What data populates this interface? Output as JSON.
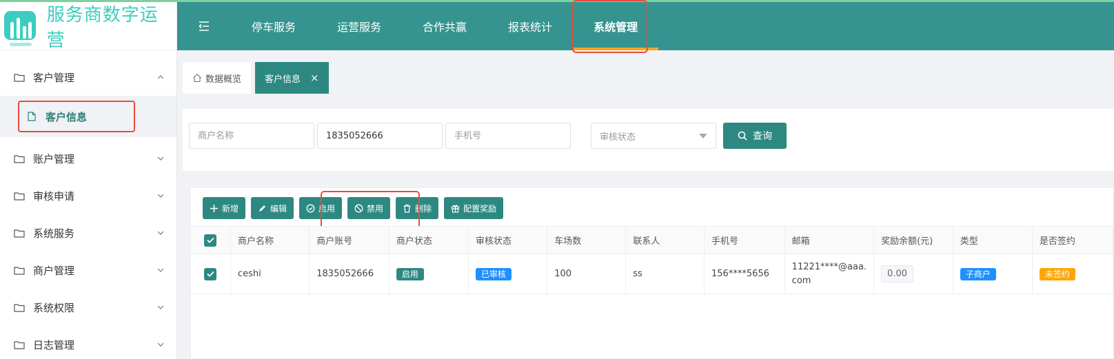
{
  "app": {
    "title": "服务商数字运营"
  },
  "sidebar": {
    "items": [
      {
        "label": "客户管理",
        "expanded": true
      },
      {
        "label": "账户管理"
      },
      {
        "label": "审核申请"
      },
      {
        "label": "系统服务"
      },
      {
        "label": "商户管理"
      },
      {
        "label": "系统权限"
      },
      {
        "label": "日志管理"
      }
    ],
    "sub_active": "客户信息"
  },
  "header": {
    "nav": [
      "停车服务",
      "运营服务",
      "合作共赢",
      "报表统计",
      "系统管理"
    ],
    "active": "系统管理"
  },
  "tabs": [
    {
      "label": "数据概览"
    },
    {
      "label": "客户信息",
      "close": "×"
    }
  ],
  "search": {
    "merchant_name_placeholder": "商户名称",
    "account_value": "1835052666",
    "phone_placeholder": "手机号",
    "audit_status_placeholder": "审核状态",
    "query_label": "查询"
  },
  "toolbar": {
    "add": "新增",
    "edit": "编辑",
    "enable": "启用",
    "disable": "禁用",
    "delete": "删除",
    "reward": "配置奖励"
  },
  "table": {
    "headers": [
      "商户名称",
      "商户账号",
      "商户状态",
      "审核状态",
      "车场数",
      "联系人",
      "手机号",
      "邮箱",
      "奖励余额(元)",
      "类型",
      "是否签约"
    ],
    "rows": [
      {
        "name": "ceshi",
        "account": "1835052666",
        "status": "启用",
        "audit": "已审核",
        "lots": "100",
        "contact": "ss",
        "phone": "156****5656",
        "email_line1": "11221****@aaa.",
        "email_line2": "com",
        "balance": "0.00",
        "type": "子商户",
        "signed": "未签约"
      }
    ]
  },
  "colors": {
    "brand": "#35948f",
    "primary": "#2e8882",
    "accent": "#f5a623",
    "highlight": "#e74c3c",
    "blue_badge": "#1e90ff",
    "orange_badge": "#ffa500"
  }
}
